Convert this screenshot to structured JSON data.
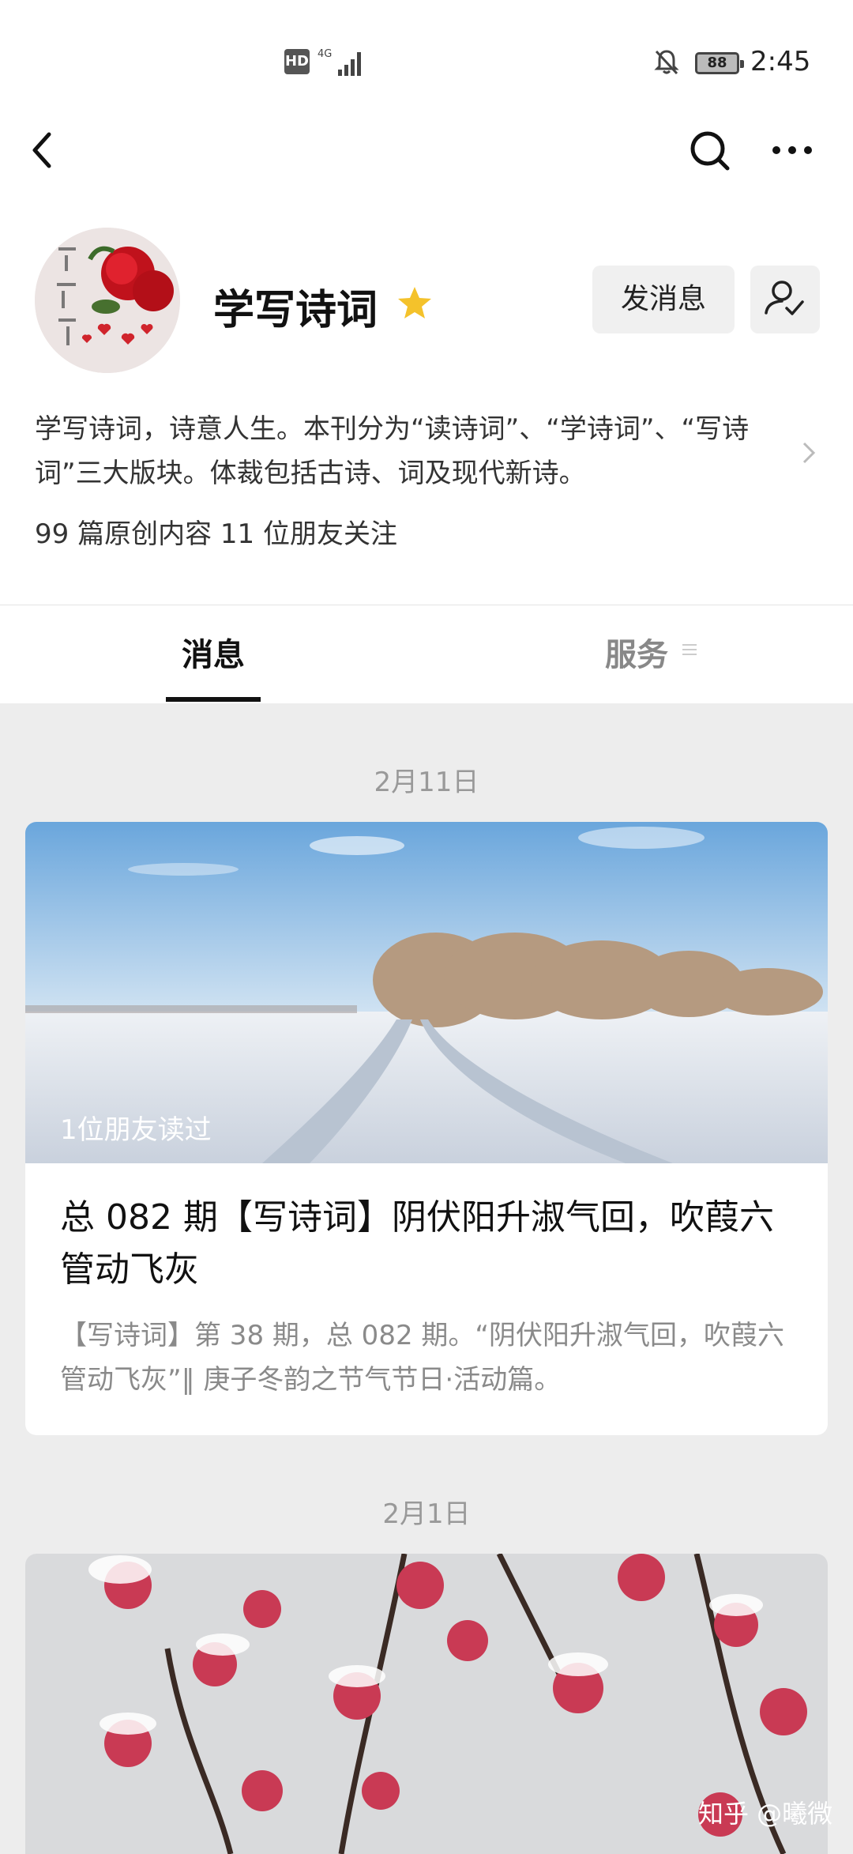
{
  "status_bar": {
    "hd": "HD",
    "network": "4G",
    "battery": "88",
    "time": "2:45"
  },
  "profile": {
    "name": "学写诗词",
    "message_button": "发消息",
    "description": "学写诗词，诗意人生。本刊分为“读诗词”、“学诗词”、“写诗词”三大版块。体裁包括古诗、词及现代新诗。",
    "stats": "99 篇原创内容  11 位朋友关注"
  },
  "tabs": [
    {
      "label": "消息"
    },
    {
      "label": "服务"
    }
  ],
  "feed": [
    {
      "date": "2月11日",
      "read_by": "1位朋友读过",
      "title": "总 082 期【写诗词】阴伏阳升淑气回，吹葭六管动飞灰",
      "summary": "【写诗词】第 38 期，总 082 期。“阴伏阳升淑气回，吹葭六管动飞灰”‖ 庚子冬韵之节气节日·活动篇。"
    },
    {
      "date": "2月1日"
    }
  ],
  "watermark": "知乎 @曦微",
  "icons": [
    "back-icon",
    "search-icon",
    "more-icon",
    "star-icon",
    "follow-check-icon",
    "chevron-right-icon",
    "menu-lines-icon",
    "bell-mute-icon",
    "signal-icon"
  ]
}
